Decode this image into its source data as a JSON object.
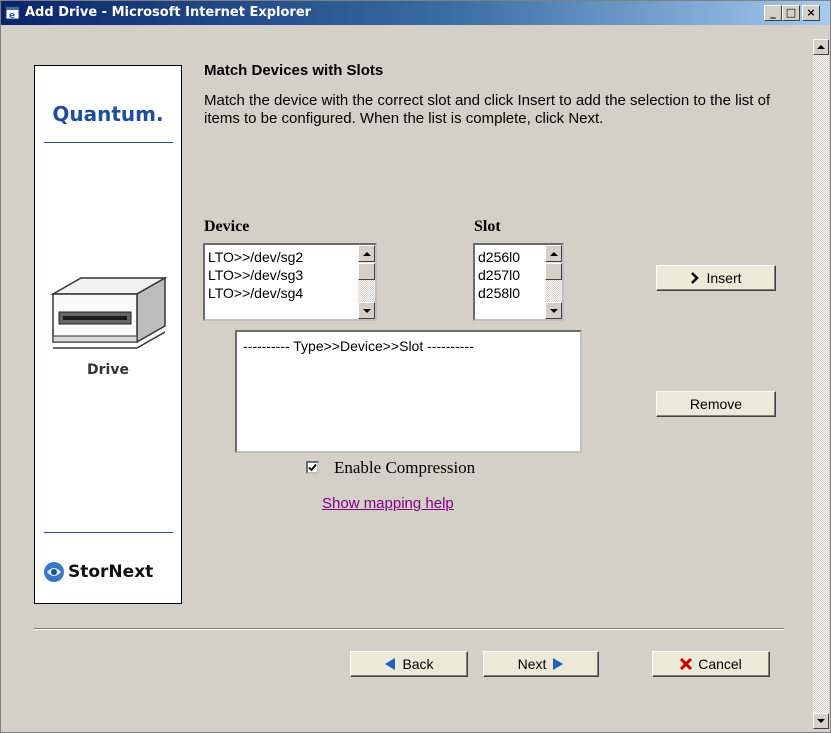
{
  "window": {
    "title": "Add Drive - Microsoft Internet Explorer"
  },
  "sidebar": {
    "brand": "Quantum.",
    "item_label": "Drive",
    "footer_brand": "StorNext"
  },
  "page": {
    "title": "Match Devices with Slots",
    "instructions": "Match the device with the correct slot and click Insert to add the selection to the list of items to be configured. When the list is complete, click Next."
  },
  "device": {
    "label": "Device",
    "options": [
      "LTO>>/dev/sg2",
      "LTO>>/dev/sg3",
      "LTO>>/dev/sg4"
    ]
  },
  "slot": {
    "label": "Slot",
    "options": [
      "d256l0",
      "d257l0",
      "d258l0"
    ]
  },
  "buttons": {
    "insert": "Insert",
    "remove": "Remove",
    "back": "Back",
    "next": "Next",
    "cancel": "Cancel"
  },
  "selection_list": {
    "header": "---------- Type>>Device>>Slot ----------"
  },
  "compression": {
    "label": "Enable Compression",
    "checked": true
  },
  "help_link": "Show mapping help",
  "colors": {
    "titlebar_start": "#0a246a",
    "titlebar_end": "#a6caf0",
    "brand_blue": "#1f4e9a",
    "link": "#800080",
    "cancel_x": "#cc0000",
    "arrow_blue": "#1f5fbf"
  }
}
